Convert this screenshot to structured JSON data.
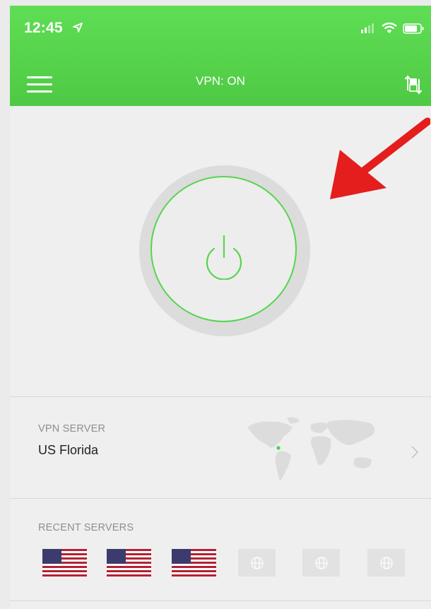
{
  "status_bar": {
    "time": "12:45"
  },
  "header": {
    "title": "VPN: ON",
    "menu_icon": "hamburger-menu-icon",
    "switch_icon": "switch-servers-icon"
  },
  "power": {
    "state": "on",
    "icon": "power-icon"
  },
  "server": {
    "label": "VPN SERVER",
    "name": "US Florida"
  },
  "recent": {
    "label": "RECENT SERVERS",
    "items": [
      {
        "type": "flag",
        "country": "US"
      },
      {
        "type": "flag",
        "country": "US"
      },
      {
        "type": "flag",
        "country": "US"
      },
      {
        "type": "globe"
      },
      {
        "type": "globe"
      },
      {
        "type": "globe"
      }
    ]
  },
  "colors": {
    "accent_green": "#56d54f",
    "annotation_arrow": "#e41d1d",
    "background": "#efefef"
  }
}
